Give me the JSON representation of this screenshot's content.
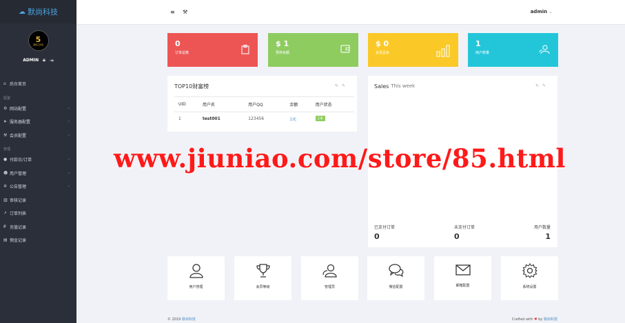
{
  "brand": {
    "name": "默尚科技",
    "icon": "cloud-icon"
  },
  "profile": {
    "avatar_number": "5",
    "avatar_caption": "源码工作室",
    "username": "ADMIN"
  },
  "sidebar": {
    "home": "后台首页",
    "section_config": "配置",
    "config_items": [
      "网站配置",
      "服务器配置",
      "会员配置"
    ],
    "section_manage": "管理",
    "manage_items": [
      "付款日/订单",
      "用户管理",
      "公告管理",
      "审核记录",
      "订单列表",
      "充值记录",
      "佣金记录"
    ]
  },
  "topbar": {
    "menu_icon": "≡",
    "tool_icon": "wrench-icon",
    "admin_label": "admin"
  },
  "stats": [
    {
      "value": "0",
      "label": "订单总数",
      "color": "#ed5555",
      "icon": "clipboard-icon"
    },
    {
      "value": "$ 1",
      "label": "预存余额",
      "color": "#8ecc60",
      "icon": "wallet-icon"
    },
    {
      "value": "$ 0",
      "label": "会员总余",
      "color": "#fbc927",
      "icon": "bar-chart-icon"
    },
    {
      "value": "1",
      "label": "用户数量",
      "color": "#23c6d8",
      "icon": "users-icon"
    }
  ],
  "top10": {
    "title": "TOP10财富榜",
    "columns": [
      "UID",
      "用户名",
      "用户QQ",
      "余额",
      "用户状态"
    ],
    "rows": [
      {
        "uid": "1",
        "username": "test001",
        "qq": "123456",
        "balance": "1元",
        "status": "正常"
      }
    ]
  },
  "sales": {
    "title": "Sales",
    "subtitle": "This week",
    "paid_label": "已支付订单",
    "paid_value": "0",
    "unpaid_label": "未支付订单",
    "unpaid_value": "0",
    "users_label": "用户数量",
    "users_value": "1"
  },
  "shortcuts": [
    {
      "label": "用户管理",
      "icon": "user-icon"
    },
    {
      "label": "会员等级",
      "icon": "trophy-icon"
    },
    {
      "label": "管理员",
      "icon": "users-icon"
    },
    {
      "label": "微信配置",
      "icon": "chat-icon"
    },
    {
      "label": "邮箱配置",
      "icon": "mail-icon"
    },
    {
      "label": "系统设置",
      "icon": "gear-icon"
    }
  ],
  "footer": {
    "copyright": "© 2019",
    "company": "默尚科技",
    "crafted": "Crafted with",
    "by": "by",
    "company_right": "默尚科技"
  },
  "watermark": "www.jiuniao.com/store/85.html"
}
